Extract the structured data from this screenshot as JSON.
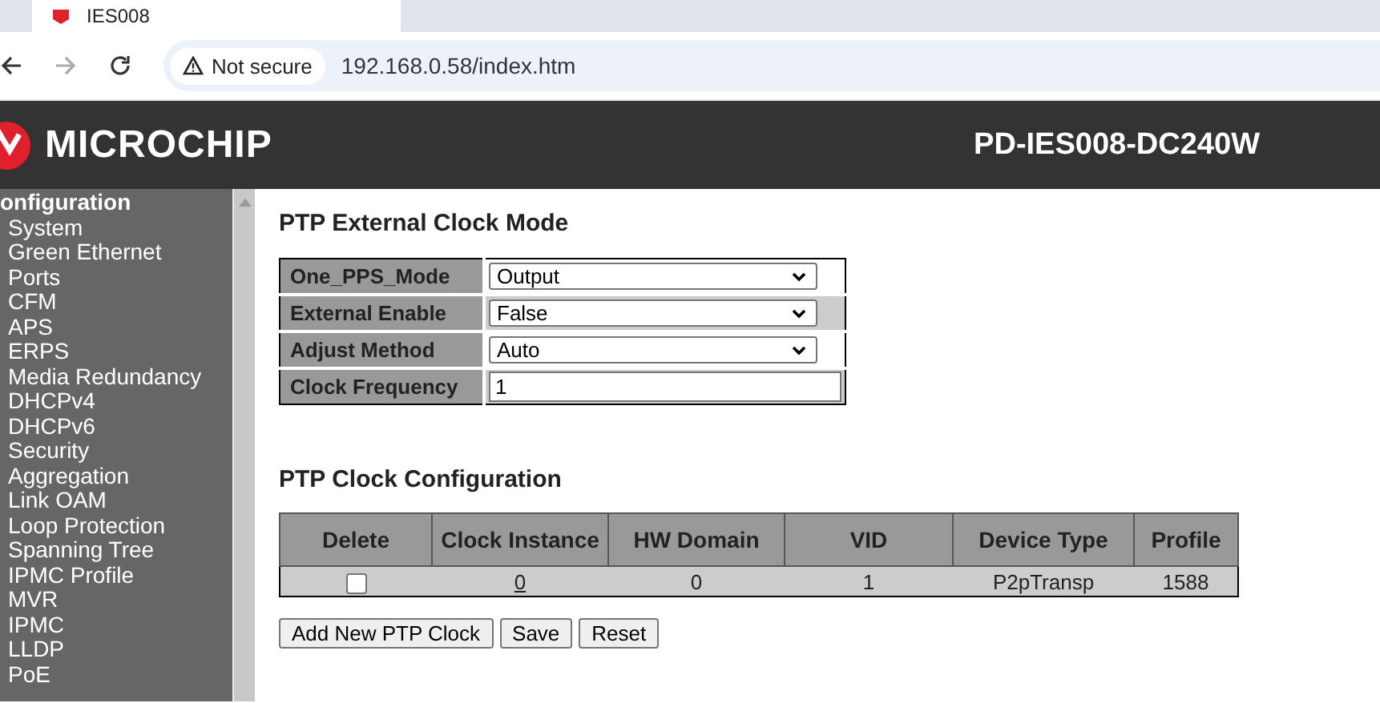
{
  "browser": {
    "tab_title": "IES008",
    "security_label": "Not secure",
    "url": "192.168.0.58/index.htm"
  },
  "header": {
    "logo_text": "MICROCHIP",
    "device_name": "PD-IES008-DC240W"
  },
  "sidebar": {
    "heading": "onfiguration",
    "items": [
      "System",
      "Green Ethernet",
      "Ports",
      "CFM",
      "APS",
      "ERPS",
      "Media Redundancy",
      "DHCPv4",
      "DHCPv6",
      "Security",
      "Aggregation",
      "Link OAM",
      "Loop Protection",
      "Spanning Tree",
      "IPMC Profile",
      "MVR",
      "IPMC",
      "LLDP",
      "PoE"
    ]
  },
  "external_clock": {
    "title": "PTP External Clock Mode",
    "fields": [
      {
        "label": "One_PPS_Mode",
        "kind": "select",
        "value": "Output"
      },
      {
        "label": "External Enable",
        "kind": "select",
        "value": "False"
      },
      {
        "label": "Adjust Method",
        "kind": "select",
        "value": "Auto"
      },
      {
        "label": "Clock Frequency",
        "kind": "text",
        "value": "1"
      }
    ]
  },
  "clock_config": {
    "title": "PTP Clock Configuration",
    "columns": [
      "Delete",
      "Clock Instance",
      "HW Domain",
      "VID",
      "Device Type",
      "Profile"
    ],
    "rows": [
      {
        "delete_checked": false,
        "clock_instance": "0",
        "hw_domain": "0",
        "vid": "1",
        "device_type": "P2pTransp",
        "profile": "1588"
      }
    ]
  },
  "buttons": [
    "Add New PTP Clock",
    "Save",
    "Reset"
  ]
}
